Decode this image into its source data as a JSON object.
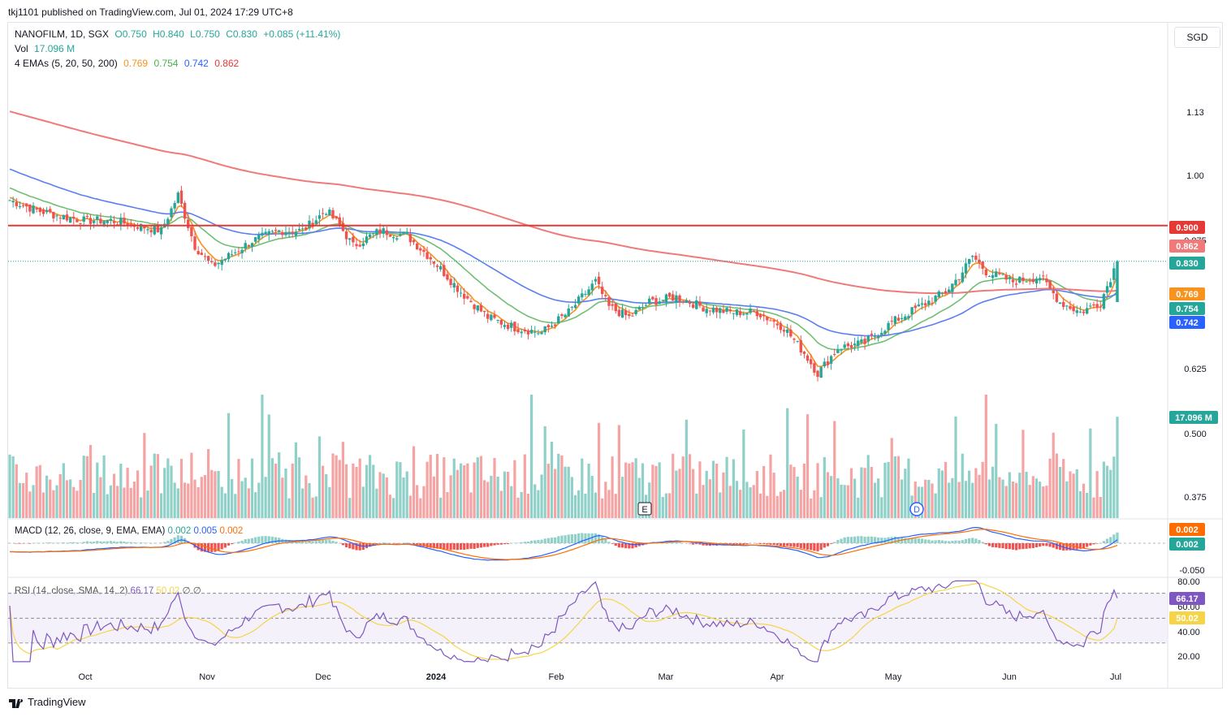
{
  "header": {
    "publish_text": "tkj1101 published on TradingView.com, Jul 01, 2024 17:29 UTC+8",
    "symbol": "NANOFILM, 1D, SGX",
    "open": "O0.750",
    "high": "H0.840",
    "low": "L0.750",
    "close": "C0.830",
    "change": "+0.085 (+11.41%)",
    "vol_label": "Vol",
    "vol_value": "17.096 M",
    "ema_label": "4 EMAs (5, 20, 50, 200)",
    "ema_values": [
      "0.769",
      "0.754",
      "0.742",
      "0.862"
    ],
    "currency": "SGD"
  },
  "macd_legend": {
    "label": "MACD (12, 26, close, 9, EMA, EMA)",
    "values": [
      "0.002",
      "0.005",
      "0.002"
    ]
  },
  "rsi_legend": {
    "label": "RSI (14, close, SMA, 14, 2)",
    "values": [
      "66.17",
      "50.02",
      "∅",
      "∅"
    ]
  },
  "footer": {
    "brand": "TradingView"
  },
  "colors": {
    "up": "#26a69a",
    "down": "#ef5350",
    "vol_up": "#8fd0c8",
    "vol_down": "#f5a3a3",
    "ema5": "#f7931e",
    "ema20": "#6fbf73",
    "ema50": "#5b7ff0",
    "ema200": "#f07a7a",
    "hline": "#e53935",
    "rsi": "#7e57c2",
    "rsi_ma": "#f5d547",
    "macd": "#2962ff",
    "signal": "#ff6d00"
  },
  "chart_data": {
    "type": "candlestick",
    "x_ticks": [
      "Oct",
      "Nov",
      "Dec",
      "2024",
      "Feb",
      "Mar",
      "Apr",
      "May",
      "Jun",
      "Jul"
    ],
    "price_ticks": [
      "1.13",
      "1.00",
      "0.875",
      "0.625",
      "0.500",
      "0.375"
    ],
    "price_labels": [
      {
        "value": "0.900",
        "color": "#e53935"
      },
      {
        "value": "0.862",
        "color": "#f07a7a"
      },
      {
        "value": "0.830",
        "color": "#26a69a"
      },
      {
        "value": "0.769",
        "color": "#f7931e"
      },
      {
        "value": "0.754",
        "color": "#26a69a"
      },
      {
        "value": "0.742",
        "color": "#2962ff"
      }
    ],
    "volume_label": "17.096 M",
    "horizontal_line": 0.9,
    "last_close": 0.83,
    "events": [
      "E",
      "D"
    ],
    "series": [
      {
        "name": "EMA 5",
        "last": 0.769
      },
      {
        "name": "EMA 20",
        "last": 0.754
      },
      {
        "name": "EMA 50",
        "last": 0.742
      },
      {
        "name": "EMA 200",
        "last": 0.862
      }
    ],
    "macd": {
      "ticks": [
        "-0.050"
      ],
      "labels": [
        "0.002",
        "0.002"
      ]
    },
    "rsi": {
      "ticks": [
        "80.00",
        "60.00",
        "40.00",
        "20.00"
      ],
      "labels": [
        "66.17",
        "50.02"
      ],
      "bands": [
        70,
        50,
        30
      ]
    }
  }
}
